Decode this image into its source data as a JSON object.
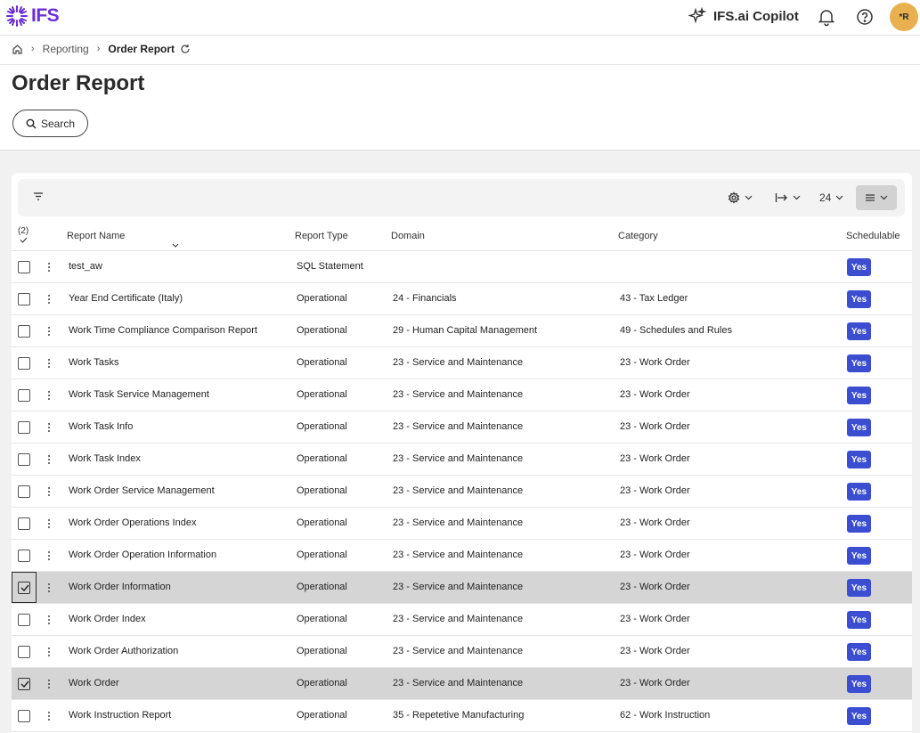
{
  "app": {
    "logo_text": "IFS",
    "copilot_label": "IFS.ai Copilot",
    "avatar_initials": "*R",
    "brand_color": "#6a2fd6",
    "accent_badge_color": "#3b4ed2"
  },
  "breadcrumb": {
    "home_icon": "home-icon",
    "items": [
      "Reporting"
    ],
    "current": "Order Report"
  },
  "page": {
    "title": "Order Report",
    "search_label": "Search"
  },
  "toolbar": {
    "page_size": "24"
  },
  "table": {
    "selected_count": "(2)",
    "columns": {
      "name": "Report Name",
      "type": "Report Type",
      "domain": "Domain",
      "category": "Category",
      "schedulable": "Schedulable"
    },
    "rows": [
      {
        "name": "test_aw",
        "type": "SQL Statement",
        "domain": "",
        "category": "",
        "schedulable": "Yes",
        "selected": false
      },
      {
        "name": "Year End Certificate (Italy)",
        "type": "Operational",
        "domain": "24 - Financials",
        "category": "43 - Tax Ledger",
        "schedulable": "Yes",
        "selected": false
      },
      {
        "name": "Work Time Compliance Comparison Report",
        "type": "Operational",
        "domain": "29 - Human Capital Management",
        "category": "49 - Schedules and Rules",
        "schedulable": "Yes",
        "selected": false
      },
      {
        "name": "Work Tasks",
        "type": "Operational",
        "domain": "23 - Service and Maintenance",
        "category": "23 - Work Order",
        "schedulable": "Yes",
        "selected": false
      },
      {
        "name": "Work Task Service Management",
        "type": "Operational",
        "domain": "23 - Service and Maintenance",
        "category": "23 - Work Order",
        "schedulable": "Yes",
        "selected": false
      },
      {
        "name": "Work Task Info",
        "type": "Operational",
        "domain": "23 - Service and Maintenance",
        "category": "23 - Work Order",
        "schedulable": "Yes",
        "selected": false
      },
      {
        "name": "Work Task Index",
        "type": "Operational",
        "domain": "23 - Service and Maintenance",
        "category": "23 - Work Order",
        "schedulable": "Yes",
        "selected": false
      },
      {
        "name": "Work Order Service Management",
        "type": "Operational",
        "domain": "23 - Service and Maintenance",
        "category": "23 - Work Order",
        "schedulable": "Yes",
        "selected": false
      },
      {
        "name": "Work Order Operations Index",
        "type": "Operational",
        "domain": "23 - Service and Maintenance",
        "category": "23 - Work Order",
        "schedulable": "Yes",
        "selected": false
      },
      {
        "name": "Work Order Operation Information",
        "type": "Operational",
        "domain": "23 - Service and Maintenance",
        "category": "23 - Work Order",
        "schedulable": "Yes",
        "selected": false
      },
      {
        "name": "Work Order Information",
        "type": "Operational",
        "domain": "23 - Service and Maintenance",
        "category": "23 - Work Order",
        "schedulable": "Yes",
        "selected": true
      },
      {
        "name": "Work Order Index",
        "type": "Operational",
        "domain": "23 - Service and Maintenance",
        "category": "23 - Work Order",
        "schedulable": "Yes",
        "selected": false
      },
      {
        "name": "Work Order Authorization",
        "type": "Operational",
        "domain": "23 - Service and Maintenance",
        "category": "23 - Work Order",
        "schedulable": "Yes",
        "selected": false
      },
      {
        "name": "Work Order",
        "type": "Operational",
        "domain": "23 - Service and Maintenance",
        "category": "23 - Work Order",
        "schedulable": "Yes",
        "selected": true
      },
      {
        "name": "Work Instruction Report",
        "type": "Operational",
        "domain": "35 - Repetetive Manufacturing",
        "category": "62 - Work Instruction",
        "schedulable": "Yes",
        "selected": false
      }
    ]
  }
}
